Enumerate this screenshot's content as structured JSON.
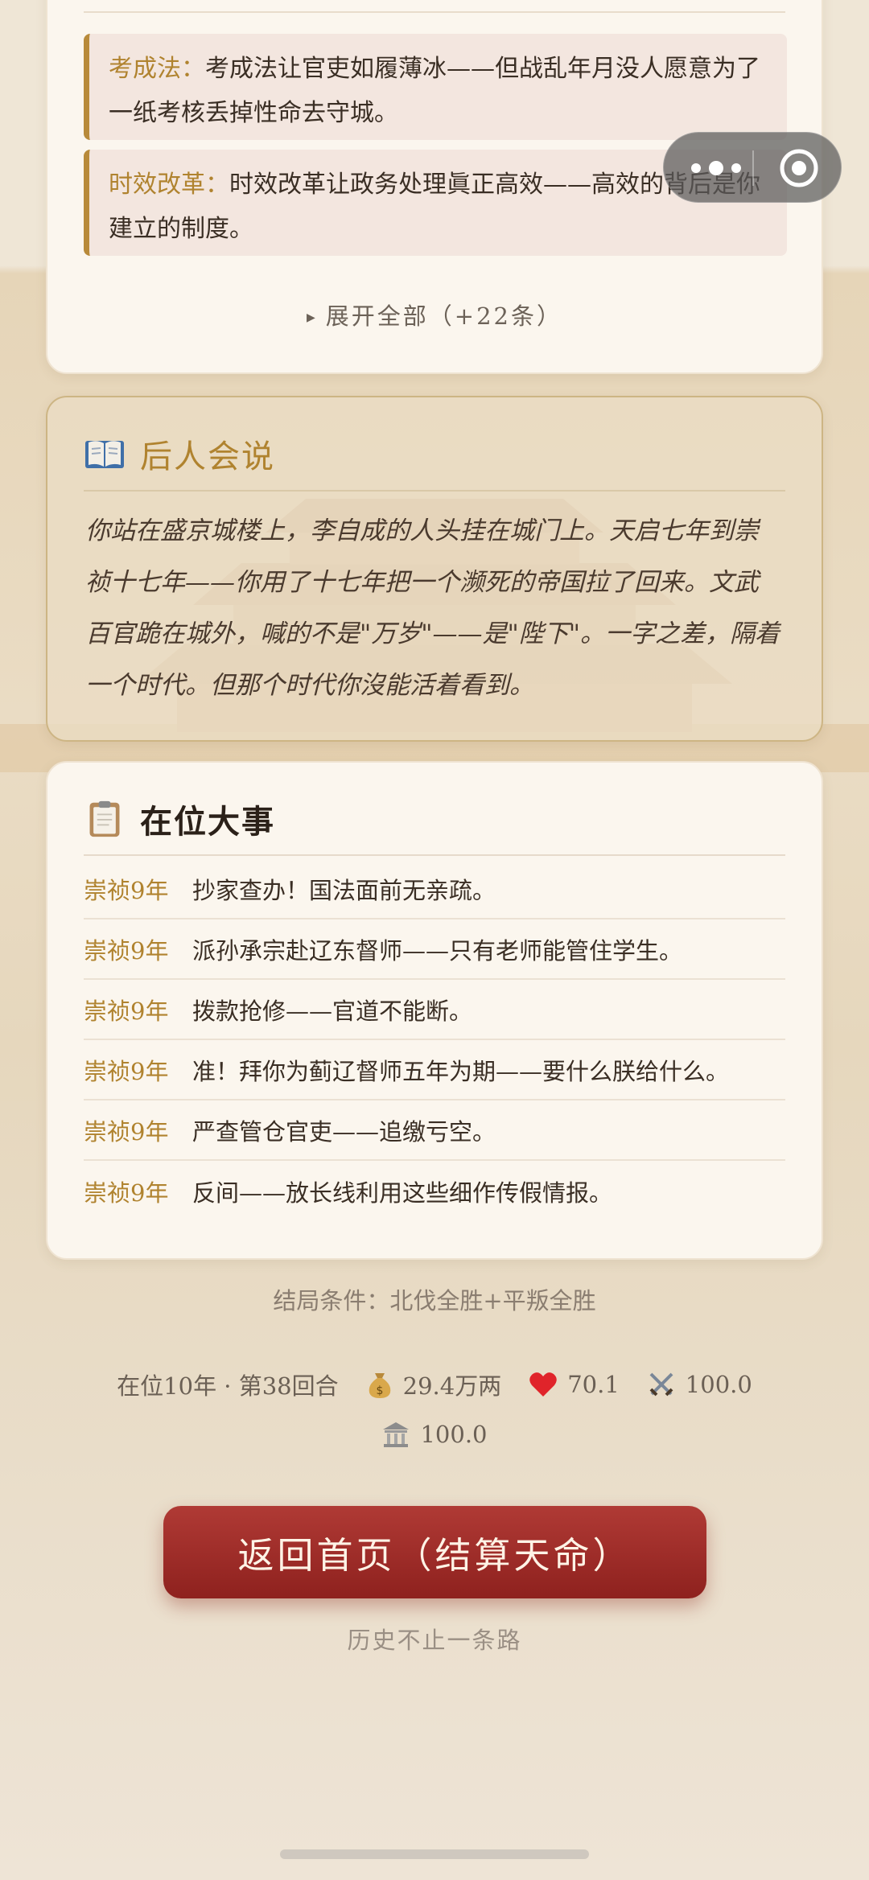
{
  "summary_card": {
    "notes": [
      {
        "key": "考成法：",
        "text": "考成法让官吏如履薄冰——但战乱年月没人愿意为了一纸考核丢掉性命去守城。"
      },
      {
        "key": "时效改革：",
        "text": "时效改革让政务处理眞正高效——高效的背后是你建立的制度。"
      }
    ],
    "expand_label": "展开全部（+22条）"
  },
  "later_comment": {
    "title": "后人会说",
    "text": "你站在盛京城楼上，李自成的人头挂在城门上。天启七年到崇祯十七年——你用了十七年把一个濒死的帝国拉了回来。文武百官跪在城外，喊的不是\"万岁\"——是\"陛下\"。一字之差，隔着一个时代。但那个时代你沒能活着看到。"
  },
  "events": {
    "title": "在位大事",
    "items": [
      {
        "year": "崇祯9年",
        "text": "抄家查办！国法面前无亲疏。"
      },
      {
        "year": "崇祯9年",
        "text": "派孙承宗赴辽东督师——只有老师能管住学生。"
      },
      {
        "year": "崇祯9年",
        "text": "拨款抢修——官道不能断。"
      },
      {
        "year": "崇祯9年",
        "text": "准！拜你为蓟辽督师五年为期——要什么朕给什么。"
      },
      {
        "year": "崇祯9年",
        "text": "严查管仓官吏——追缴亏空。"
      },
      {
        "year": "崇祯9年",
        "text": "反间——放长线利用这些细作传假情报。"
      }
    ]
  },
  "ending_condition": "结局条件：北伐全胜+平叛全胜",
  "stats": {
    "reign": "在位10年 · 第38回合",
    "treasury": "29.4万两",
    "popularity": "70.1",
    "military": "100.0",
    "court": "100.0"
  },
  "cta_label": "返回首页（结算天命）",
  "tagline": "历史不止一条路",
  "colors": {
    "accent_gold": "#b0832f",
    "cta_red": "#a02e2a",
    "card_bg": "#fbf6ee"
  }
}
